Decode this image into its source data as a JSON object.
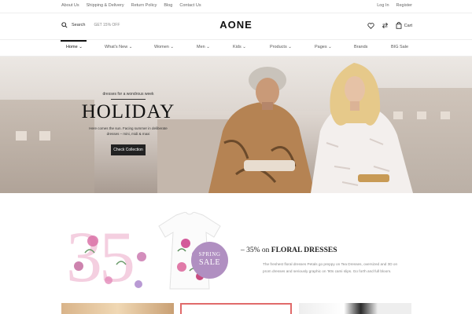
{
  "topbar": {
    "links": [
      "About Us",
      "Shipping & Delivery",
      "Return Policy",
      "Blog",
      "Contact Us"
    ],
    "login": "Log In",
    "register": "Register"
  },
  "header": {
    "search_label": "Search",
    "promo_text": "GET 15% OFF",
    "logo": "AONE",
    "cart_label": "Cart",
    "icons": [
      "search-icon",
      "heart-icon",
      "compare-icon",
      "bag-icon"
    ]
  },
  "nav": {
    "items": [
      {
        "label": "Home"
      },
      {
        "label": "What's New"
      },
      {
        "label": "Women"
      },
      {
        "label": "Men"
      },
      {
        "label": "Kids"
      },
      {
        "label": "Products"
      },
      {
        "label": "Pages"
      },
      {
        "label": "Brands"
      },
      {
        "label": "BIG Sale"
      }
    ],
    "active": "Home"
  },
  "hero": {
    "kicker": "dresses for a wondrous week",
    "title": "HOLIDAY",
    "description": "Here comes the sun. Facing summer in deliberate dresses – mini, midi & maxi",
    "cta": "Check Collection"
  },
  "promo": {
    "big_number": "35",
    "headline_prefix": "– 35% on",
    "headline": "FLORAL DRESSES",
    "description": "The freshest floral dresses Petals go preppy on Tea Dresses, oversized and 3D on prom dresses and seriously graphic on '90s cami slips. Go forth and full bloom.",
    "badge_line1": "SPRING",
    "badge_line2": "SALE"
  },
  "colors": {
    "accent": "#111111",
    "badge": "#b08fc1",
    "pink": "#f4cfe0"
  }
}
